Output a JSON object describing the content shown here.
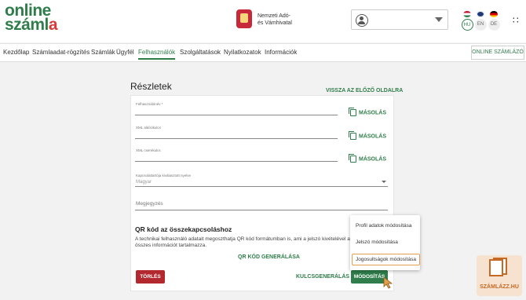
{
  "header": {
    "logo_line1": "online",
    "logo_line2a": "száml",
    "logo_line2b": "a",
    "agency_line1": "Nemzeti Adó-",
    "agency_line2": "és Vámhivatal",
    "languages": [
      {
        "code": "HU",
        "active": true
      },
      {
        "code": "EN",
        "active": false
      },
      {
        "code": "DE",
        "active": false
      }
    ]
  },
  "menu": {
    "items": [
      "Kezdőlap",
      "Számlaadat-rögzítés",
      "Számlák",
      "Ügyfél",
      "Felhasználók",
      "Szolgáltatások",
      "Nyilatkozatok",
      "Információk"
    ],
    "active": "Felhasználók",
    "online_button": "ONLINE SZÁMLÁZÓ"
  },
  "page": {
    "title": "Részletek",
    "back_link": "VISSZA AZ ELŐZŐ OLDALRA",
    "fields": {
      "username_label": "Felhasználónév *",
      "xml_sign_label": "XML aláírókulcs",
      "xml_replace_label": "XML cserekulcs",
      "language_label": "Kapcsolattartója kiválasztott nyelve",
      "language_value": "Magyar",
      "note_placeholder": "Megjegyzés"
    },
    "copy_label": "MÁSOLÁS",
    "qr": {
      "title": "QR kód az összekapcsoláshoz",
      "description": "A technikai felhasználó adatait megoszthatja QR kód formátumban is, ami a jelszó kivételével az összes információt tartalmazza.",
      "generate": "QR KÓD GENERÁLÁSA"
    },
    "buttons": {
      "delete": "TÖRLÉS",
      "key_generate": "KULCSGENERÁLÁS",
      "modify": "MÓDOSÍTÁS"
    },
    "dropdown_menu": [
      "Profil adatok módosítása",
      "Jelszó módosítása",
      "Jogosultságok módosítása"
    ],
    "dropdown_selected": "Jogosultságok módosítása"
  },
  "badge": {
    "text": "SZÁMLÁZZ.HU"
  },
  "colors": {
    "brand_green": "#2f7d4a",
    "danger": "#b3272f",
    "accent_orange": "#c46a24"
  }
}
